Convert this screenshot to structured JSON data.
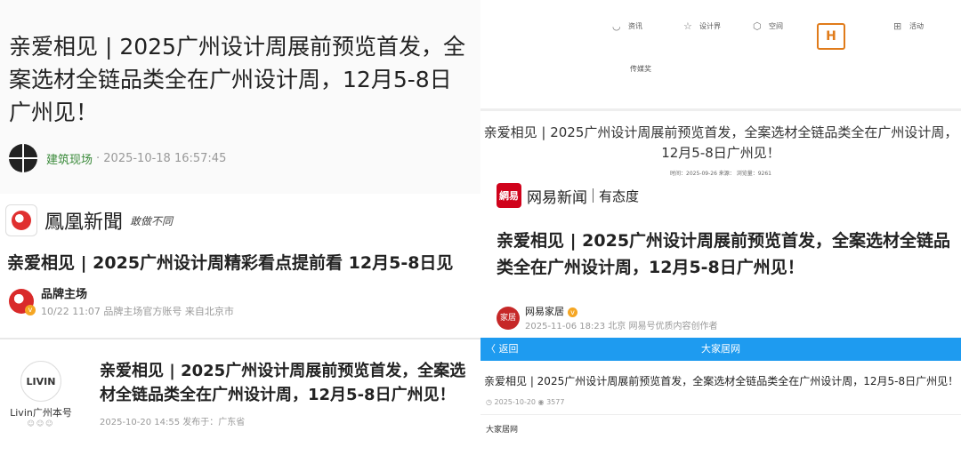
{
  "panel1": {
    "title": "亲爱相见 | 2025广州设计周展前预览首发，全案选材全链品类全在广州设计周，12月5-8日广州见！",
    "source": "建筑现场",
    "datetime": "· 2025-10-18 16:57:45"
  },
  "panel2": {
    "brand_name": "鳳凰新聞",
    "brand_slogan": "敢做不同",
    "title": "亲爱相见 | 2025广州设计周精彩看点提前看 12月5-8日见",
    "account_name": "品牌主场",
    "account_meta": "10/22 11:07   品牌主场官方账号   来自北京市",
    "verified_icon": "v-badge"
  },
  "panel3": {
    "logo_text": "LIVIN",
    "account_name": "Livin广州本号",
    "dots": "☺☺☺",
    "title": "亲爱相见 | 2025广州设计周展前预览首发，全案选材全链品类全在广州设计周，12月5-8日广州见！",
    "meta": "2025-10-20 14:55     发布于：广东省"
  },
  "panel4": {
    "nav": [
      {
        "label": "资讯",
        "icon": "eye-icon"
      },
      {
        "label": "设计界",
        "icon": "star-icon"
      },
      {
        "label": "空间",
        "icon": "cube-icon"
      },
      {
        "label": "活动",
        "icon": "grid-icon"
      }
    ],
    "nav_second_row": "传媒奖",
    "brand_mark": "H",
    "center_title": "亲爱相见 | 2025广州设计周展前预览首发，全案选材全链品类全在广州设计周，12月5-8日广州见！",
    "center_meta": "时间：2025-09-26 来源：   浏览量：9261",
    "netease_logo": "網易",
    "netease_name": "网易新闻",
    "netease_slogan": "有态度",
    "big_title": "亲爱相见 | 2025广州设计周展前预览首发，全案选材全链品类全在广州设计周，12月5-8日广州见！",
    "account_avatar": "家居",
    "account_name": "网易家居",
    "account_verified": "v",
    "account_meta": "2025-11-06 18:23 北京 网易号优质内容创作者"
  },
  "panel5": {
    "back_label": "〈 返回",
    "bar_title": "大家居网",
    "title": "亲爱相见 | 2025广州设计周展前预览首发，全案选材全链品类全在广州设计周，12月5-8日广州见！",
    "meta": "◷ 2025-10-20   ◉ 3577",
    "source": "大家居网"
  },
  "colors": {
    "accent_blue": "#1e9bf0",
    "netease_red": "#d0021b",
    "ifeng_red": "#e03030",
    "source_green": "#3a8a3a",
    "verified_orange": "#f5a623"
  }
}
